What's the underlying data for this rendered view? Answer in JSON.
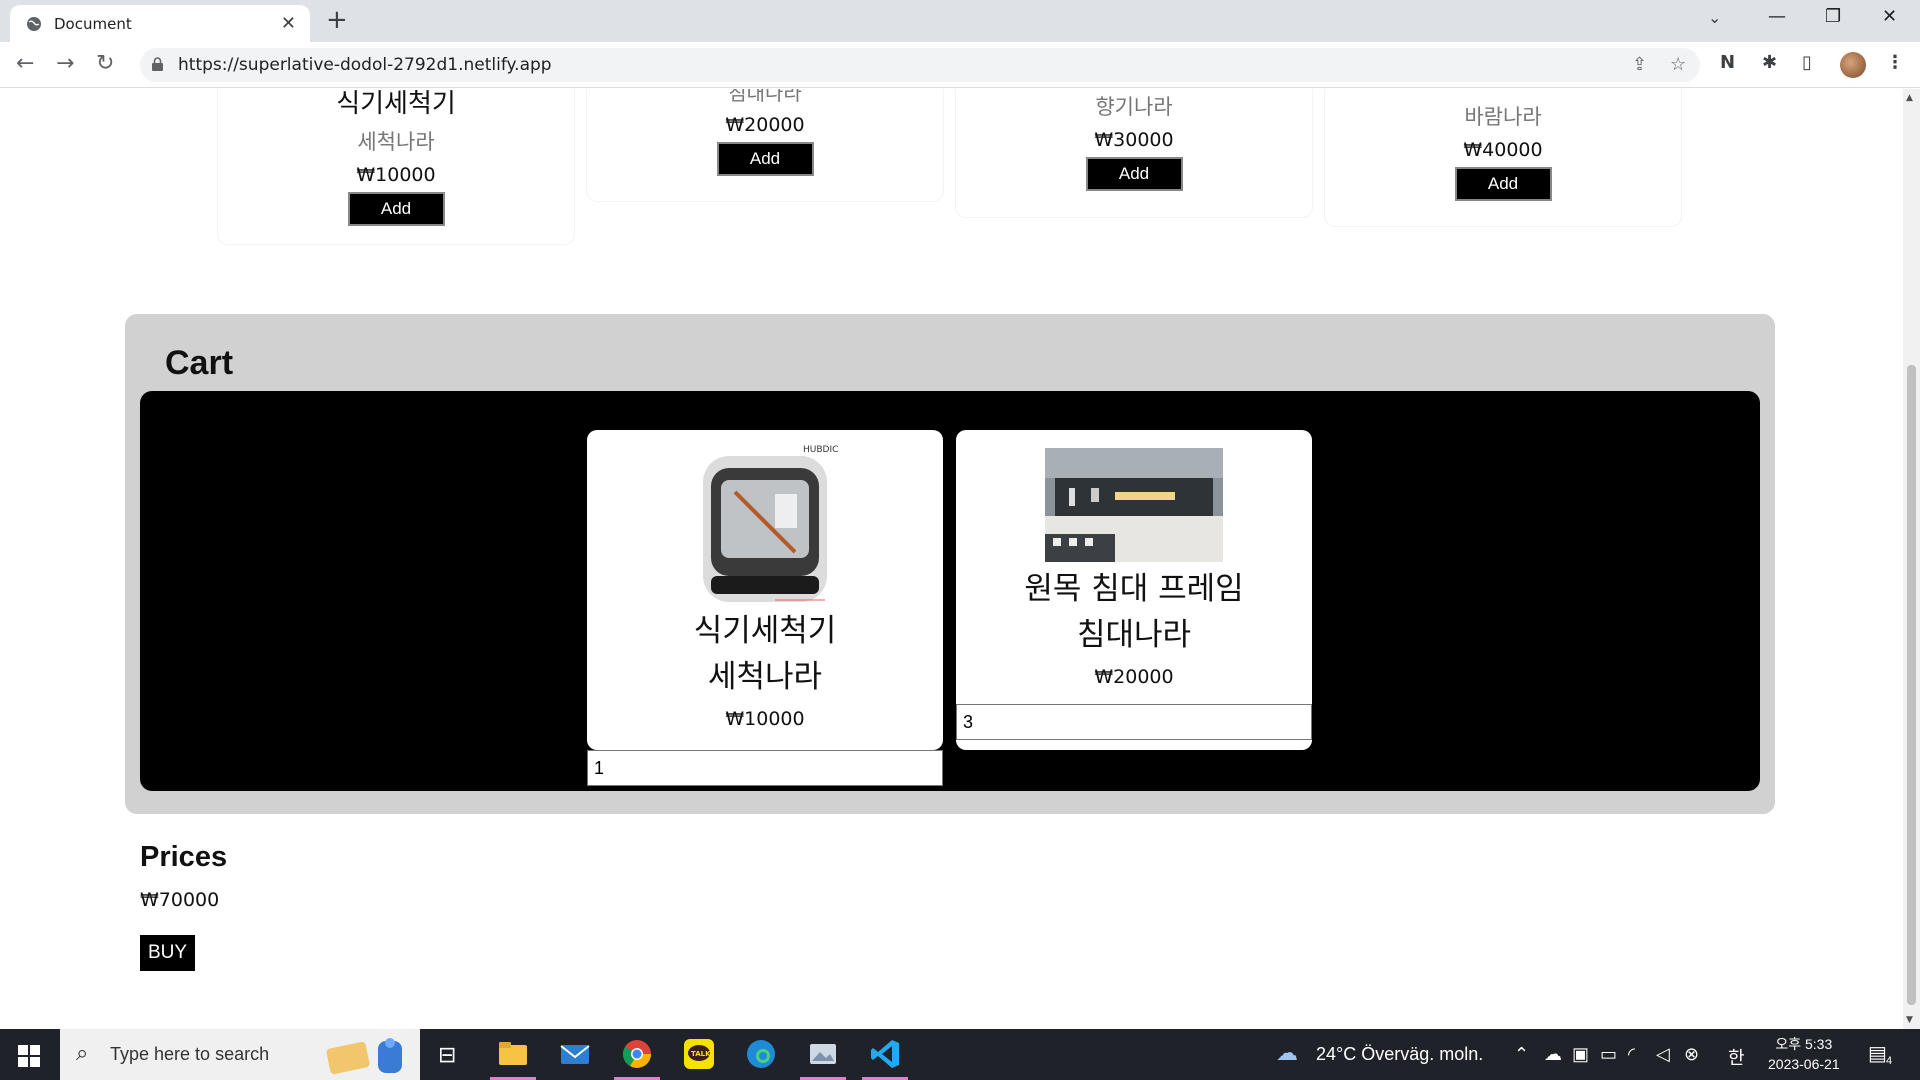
{
  "browser": {
    "tab_title": "Document",
    "url": "https://superlative-dodol-2792d1.netlify.app"
  },
  "products": [
    {
      "name": "식기세척기",
      "store": "세척나라",
      "price": "₩10000",
      "add_label": "Add"
    },
    {
      "name": "침대나라",
      "store": "",
      "price": "₩20000",
      "add_label": "Add"
    },
    {
      "name": "",
      "store": "향기나라",
      "price": "₩30000",
      "add_label": "Add"
    },
    {
      "name": "",
      "store": "바람나라",
      "price": "₩40000",
      "add_label": "Add"
    }
  ],
  "cart": {
    "title": "Cart",
    "items": [
      {
        "name": "식기세척기",
        "store": "세척나라",
        "price": "₩10000",
        "quantity": "1",
        "image": "dishwasher-image"
      },
      {
        "name": "원목 침대 프레임",
        "store": "침대나라",
        "price": "₩20000",
        "quantity": "3",
        "image": "bed-frame-image"
      }
    ]
  },
  "prices": {
    "title": "Prices",
    "total": "₩70000",
    "buy_label": "BUY"
  },
  "taskbar": {
    "search_placeholder": "Type here to search",
    "weather": "24°C  Överväg. moln.",
    "ime": "한",
    "time": "오후 5:33",
    "date": "2023-06-21",
    "notifications": "4"
  }
}
